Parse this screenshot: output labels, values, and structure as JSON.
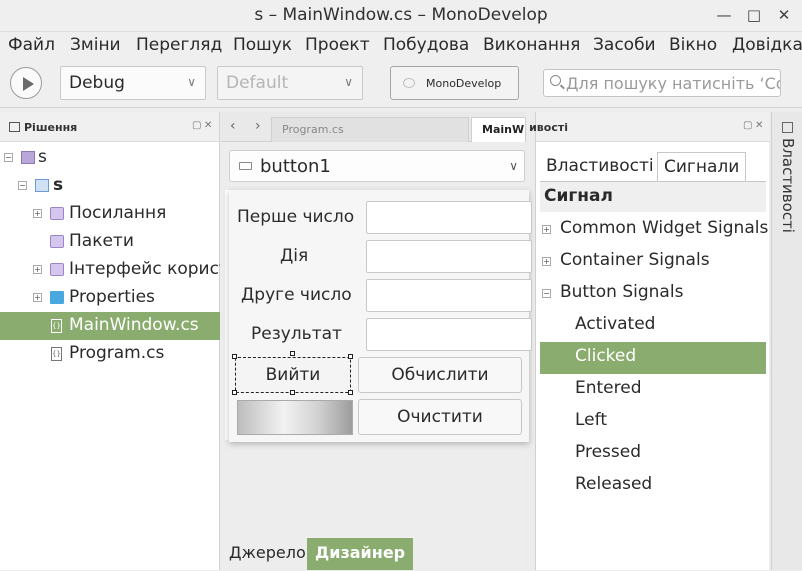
{
  "window": {
    "title": "s – MainWindow.cs – MonoDevelop"
  },
  "menu": [
    "Файл",
    "Зміни",
    "Перегляд",
    "Пошук",
    "Проект",
    "Побудова",
    "Виконання",
    "Засоби",
    "Вікно",
    "Довідка"
  ],
  "toolbar": {
    "config": "Debug",
    "platform": "Default",
    "runtime_button": "MonoDevelop",
    "search_placeholder": "Для пошуку натисніть ‘Control+,’"
  },
  "solution_pad": {
    "title": "Рішення",
    "items": [
      {
        "label": "s",
        "icon": "solution-icon"
      },
      {
        "label": "s",
        "icon": "project-icon"
      },
      {
        "label": "Посилання",
        "icon": "references-icon"
      },
      {
        "label": "Пакети",
        "icon": "packages-icon"
      },
      {
        "label": "Інтерфейс користувача",
        "icon": "ui-folder-icon"
      },
      {
        "label": "Properties",
        "icon": "folder-icon"
      },
      {
        "label": "MainWindow.cs",
        "icon": "cs-file-icon",
        "selected": true
      },
      {
        "label": "Program.cs",
        "icon": "cs-file-icon"
      }
    ]
  },
  "editor": {
    "tabs": [
      {
        "label": "Program.cs",
        "active": false
      },
      {
        "label": "MainWindow.cs",
        "active": true
      }
    ],
    "widget_selector": "button1",
    "form": {
      "labels": [
        "Перше число",
        "Дія",
        "Друге число",
        "Результат"
      ],
      "buttons": [
        "Вийти",
        "Обчислити",
        "Очистити"
      ]
    },
    "bottom_tabs": [
      {
        "label": "Джерело",
        "selected": false
      },
      {
        "label": "Дизайнер",
        "selected": true
      }
    ]
  },
  "properties_pad": {
    "title": "Властивості",
    "tabs": [
      {
        "label": "Властивості",
        "selected": false
      },
      {
        "label": "Сигнали",
        "selected": true
      }
    ],
    "header": "Сигнал",
    "signals": [
      {
        "label": "Common Widget Signals",
        "group": true,
        "expander": "+"
      },
      {
        "label": "Container Signals",
        "group": true,
        "expander": "+"
      },
      {
        "label": "Button Signals",
        "group": true,
        "expander": "−"
      },
      {
        "label": "Activated",
        "group": false
      },
      {
        "label": "Clicked",
        "group": false,
        "selected": true
      },
      {
        "label": "Entered",
        "group": false
      },
      {
        "label": "Left",
        "group": false
      },
      {
        "label": "Pressed",
        "group": false
      },
      {
        "label": "Released",
        "group": false
      }
    ]
  },
  "side_strip": {
    "label": "Властивості"
  },
  "colors": {
    "selection": "#8aad6f",
    "background": "#ececec"
  }
}
